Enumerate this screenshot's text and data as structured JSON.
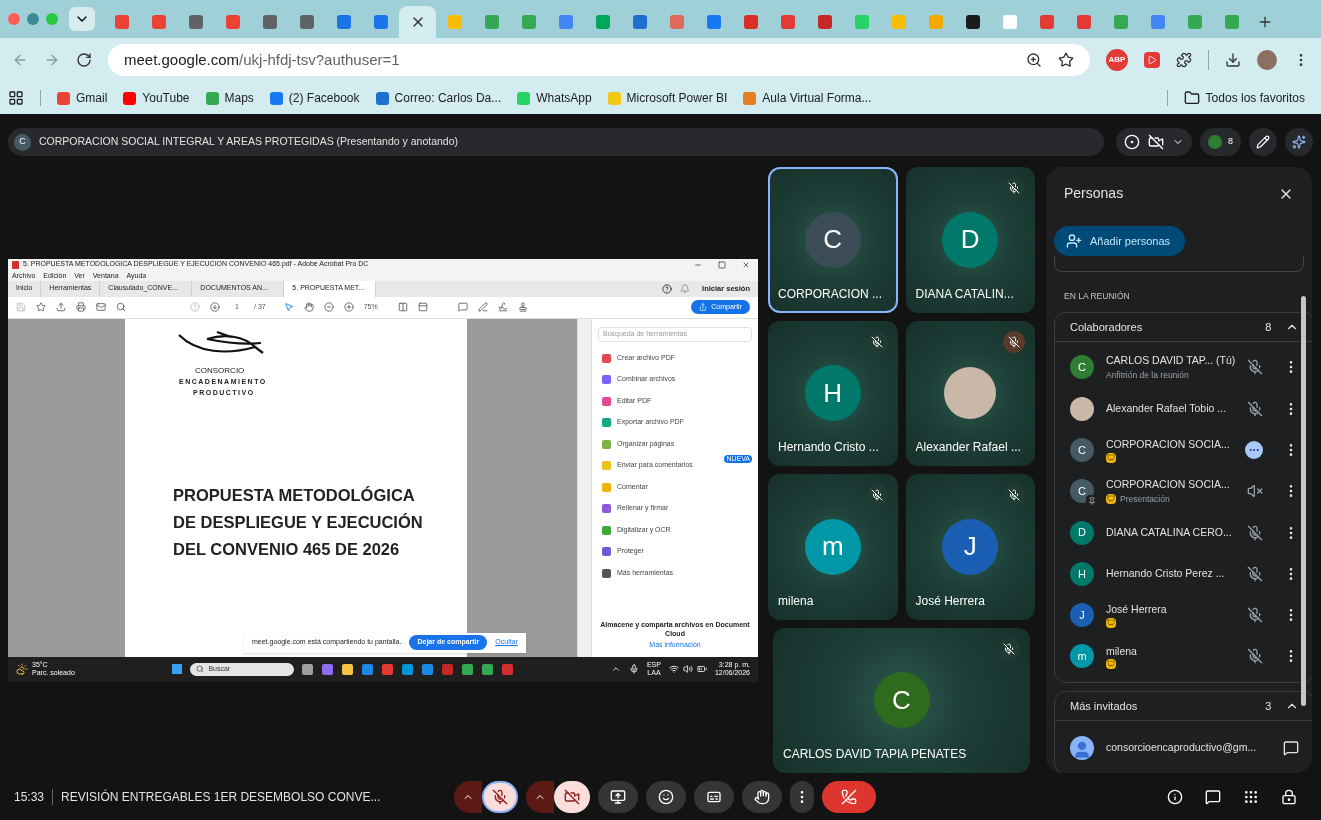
{
  "browser": {
    "tabs": [
      {
        "color": "#ea4335",
        "selected": false
      },
      {
        "color": "#ea4335",
        "selected": false
      },
      {
        "color": "#5f6368",
        "selected": false
      },
      {
        "color": "#ea4335",
        "selected": false
      },
      {
        "color": "#5f6368",
        "selected": false
      },
      {
        "color": "#5f6368",
        "selected": false
      },
      {
        "color": "#1a73e8",
        "selected": false
      },
      {
        "color": "#1a73e8",
        "selected": false
      },
      {
        "selected": true
      },
      {
        "color": "#fbbc04",
        "selected": false
      },
      {
        "color": "#34a853",
        "selected": false
      },
      {
        "color": "#34a853",
        "selected": false
      },
      {
        "color": "#4285f4",
        "selected": false
      },
      {
        "color": "#00a65a",
        "selected": false
      },
      {
        "color": "#1f6fd1",
        "selected": false
      },
      {
        "color": "#e06a5a",
        "selected": false
      },
      {
        "color": "#1877f2",
        "selected": false
      },
      {
        "color": "#d93025",
        "selected": false
      },
      {
        "color": "#e53935",
        "selected": false
      },
      {
        "color": "#c62828",
        "selected": false
      },
      {
        "color": "#25d366",
        "selected": false
      },
      {
        "color": "#fbbc04",
        "selected": false
      },
      {
        "color": "#f2a900",
        "selected": false
      },
      {
        "color": "#1b1b1b",
        "selected": false
      },
      {
        "color": "#ffffff",
        "selected": false
      },
      {
        "color": "#e53935",
        "selected": false
      },
      {
        "color": "#e53935",
        "selected": false
      },
      {
        "color": "#34a853",
        "selected": false
      },
      {
        "color": "#4285f4",
        "selected": false
      },
      {
        "color": "#34a853",
        "selected": false
      },
      {
        "color": "#34a853",
        "selected": false
      }
    ],
    "address_host": "meet.google.com",
    "address_path": "/ukj-hfdj-tsv?authuser=1",
    "extension_label": "ABP",
    "bookmarks": [
      {
        "label": "Gmail",
        "color": "#ea4335"
      },
      {
        "label": "YouTube",
        "color": "#ff0000"
      },
      {
        "label": "Maps",
        "color": "#34a853"
      },
      {
        "label": "(2) Facebook",
        "color": "#1877f2"
      },
      {
        "label": "Correo: Carlos Da...",
        "color": "#1f6fd1"
      },
      {
        "label": "WhatsApp",
        "color": "#25d366"
      },
      {
        "label": "Microsoft Power BI",
        "color": "#f2c811"
      },
      {
        "label": "Aula Virtual Forma...",
        "color": "#e67e22"
      }
    ],
    "all_bookmarks": "Todos los favoritos"
  },
  "meeting": {
    "title_initial": "C",
    "title": "CORPORACION SOCIAL INTEGRAL Y AREAS PROTEGIDAS (Presentando y anotando)",
    "participant_count": "8",
    "time": "15:33",
    "name": "REVISIÓN ENTREGABLES 1ER DESEMBOLSO CONVE...",
    "mic_on": false,
    "camera_on": false
  },
  "shared_screen": {
    "window_title": "5. PROPUESTA METODOLOGICA DESPLIEGUE Y EJECUCION CONVENIO 465.pdf - Adobe Acrobat Pro DC",
    "menu": [
      "Archivo",
      "Edición",
      "Ver",
      "Ventana",
      "Ayuda"
    ],
    "tabs": [
      {
        "label": "Inicio",
        "selected": false
      },
      {
        "label": "Herramientas",
        "selected": false
      },
      {
        "label": "Clausulado_CONVE...",
        "selected": false
      },
      {
        "label": "DOCUMENTOS AN...",
        "selected": false
      },
      {
        "label": "5. PROPUESTA MET...",
        "selected": true
      }
    ],
    "sign_in": "Iniciar sesión",
    "page": "1",
    "page_total": "/ 37",
    "zoom": "75%",
    "share": "Compartir",
    "document": {
      "logo_lines": [
        "CONSORCIO",
        "ENCADENAMIENTO",
        "PRODUCTIVO"
      ],
      "heading": [
        "PROPUESTA METODOLÓGICA",
        "DE DESPLIEGUE Y EJECUCIÓN",
        "DEL CONVENIO 465 DE 2026"
      ]
    },
    "tool_search_placeholder": "Búsqueda de herramientas",
    "tools": [
      {
        "label": "Crear archivo PDF",
        "color": "#e34850"
      },
      {
        "label": "Combinar archivos",
        "color": "#7b61ff"
      },
      {
        "label": "Editar PDF",
        "color": "#e34895"
      },
      {
        "label": "Exportar archivo PDF",
        "color": "#12a88a"
      },
      {
        "label": "Organizar páginas",
        "color": "#7cb342"
      },
      {
        "label": "Enviar para comentarios",
        "color": "#e8c31a",
        "badge": "NUEVA"
      },
      {
        "label": "Comentar",
        "color": "#f0b400"
      },
      {
        "label": "Rellenar y firmar",
        "color": "#8a5cd8"
      },
      {
        "label": "Digitalizar y OCR",
        "color": "#3aaa35"
      },
      {
        "label": "Proteger",
        "color": "#6e5ad6"
      },
      {
        "label": "Más herramientas",
        "color": "#555555"
      }
    ],
    "cloud_text": "Almacene y comparta archivos en Document Cloud",
    "cloud_link": "Más información",
    "share_notice": "meet.google.com está compartiendo tu pantalla.",
    "stop_sharing": "Dejar de compartir",
    "hide": "Ocultar",
    "taskbar": {
      "temperature": "35°C",
      "weather": "Parc. soleado",
      "search_placeholder": "Buscar",
      "apps": [
        {
          "color": "#9e9e9e"
        },
        {
          "color": "#8e6cf0"
        },
        {
          "color": "#f6c344"
        },
        {
          "color": "#1e88e5"
        },
        {
          "color": "#e53935"
        },
        {
          "color": "#0096d6"
        },
        {
          "color": "#1e88e5"
        },
        {
          "color": "#c62828"
        },
        {
          "color": "#34a853"
        },
        {
          "color": "#34a853"
        },
        {
          "color": "#d32f2f"
        }
      ],
      "language": "ESP",
      "layout": "LAA",
      "time": "3:28 p. m.",
      "date": "12/06/2026"
    }
  },
  "tile_rows": [
    [
      {
        "name": "CORPORACION ...",
        "initial": "C",
        "color": "#3c4d57",
        "muted": false,
        "photo": false,
        "active_speaker": true
      },
      {
        "name": "DIANA CATALIN...",
        "initial": "D",
        "color": "#00796b",
        "muted": true,
        "photo": false,
        "active_speaker": false
      }
    ],
    [
      {
        "name": "Hernando Cristo ...",
        "initial": "H",
        "color": "#00796b",
        "muted": true,
        "photo": false,
        "active_speaker": false
      },
      {
        "name": "Alexander Rafael ...",
        "muted": true,
        "photo": true,
        "active_speaker": false
      }
    ],
    [
      {
        "name": "milena",
        "initial": "m",
        "color": "#0097a7",
        "muted": true,
        "photo": false,
        "active_speaker": false
      },
      {
        "name": "José Herrera",
        "initial": "J",
        "color": "#1a5fb4",
        "muted": true,
        "photo": false,
        "active_speaker": false
      }
    ],
    [
      {
        "name": "CARLOS DAVID TAPIA PENATES",
        "initial": "C",
        "color": "#2e6b1f",
        "muted": true,
        "photo": false,
        "active_speaker": false
      }
    ]
  ],
  "people_panel": {
    "title": "Personas",
    "add_button": "Añadir personas",
    "section_label": "EN LA REUNIÓN",
    "groups": [
      {
        "title": "Colaboradores",
        "count": "8",
        "expanded": true,
        "people": [
          {
            "kind": "member",
            "initial": "C",
            "color": "#2e7d32",
            "name": "CARLOS DAVID TAP... (Tú)",
            "subtitle": "Anfitrión de la reunión",
            "badge": false,
            "pinned": false,
            "photo": false,
            "muted": true
          },
          {
            "kind": "member",
            "name": "Alexander Rafael Tobio ...",
            "badge": false,
            "pinned": false,
            "photo": true,
            "muted": true
          },
          {
            "kind": "member",
            "initial": "C",
            "color": "#455a64",
            "name": "CORPORACION SOCIA...",
            "badge": true,
            "pinned": false,
            "photo": false,
            "speaking": true
          },
          {
            "kind": "member",
            "initial": "C",
            "color": "#455a64",
            "name": "CORPORACION SOCIA...",
            "subtitle": "Presentación",
            "badge": true,
            "pinned": true,
            "photo": false,
            "audio_muted": true
          },
          {
            "kind": "member",
            "initial": "D",
            "color": "#00796b",
            "name": "DIANA CATALINA CERO...",
            "badge": false,
            "pinned": false,
            "photo": false,
            "muted": true
          },
          {
            "kind": "member",
            "initial": "H",
            "color": "#00796b",
            "name": "Hernando Cristo Perez ...",
            "badge": false,
            "pinned": false,
            "photo": false,
            "muted": true
          },
          {
            "kind": "member",
            "initial": "J",
            "color": "#1a5fb4",
            "name": "José Herrera",
            "badge": true,
            "pinned": false,
            "photo": false,
            "muted": true
          },
          {
            "kind": "member",
            "initial": "m",
            "color": "#0097a7",
            "name": "milena",
            "badge": true,
            "pinned": false,
            "photo": false,
            "muted": true
          }
        ]
      },
      {
        "title": "Más invitados",
        "count": "3",
        "expanded": true,
        "people": [
          {
            "kind": "guest",
            "name": "consorcioencaproductivo@gm..."
          }
        ]
      }
    ]
  }
}
